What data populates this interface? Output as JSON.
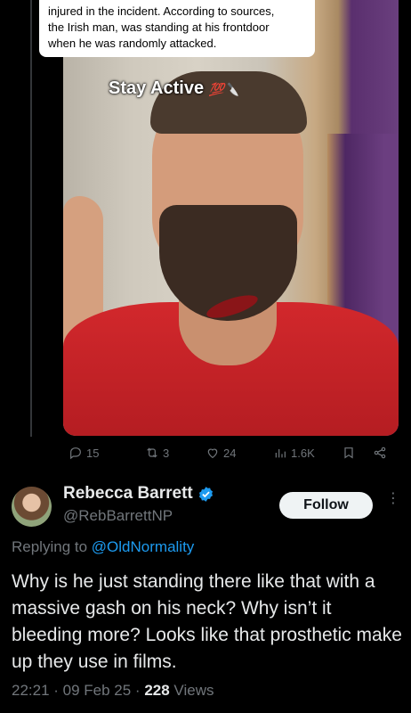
{
  "quoted_post": {
    "caption_lines": [
      "injured in the incident. According to sources,",
      "the Irish man, was standing at his frontdoor",
      "when he was randomly attacked."
    ],
    "overlay_text": "Stay Active",
    "overlay_emoji": "💯🔪"
  },
  "actions": {
    "replies": "15",
    "reposts": "3",
    "likes": "24",
    "views": "1.6K"
  },
  "reply": {
    "display_name": "Rebecca Barrett",
    "handle": "@RebBarrettNP",
    "follow_label": "Follow",
    "more_label": "⋮",
    "replying_prefix": "Replying to",
    "replying_to": "@OldNormality",
    "text": "Why is he just standing there like that with a massive gash on his neck? Why isn’t it bleeding more? Looks like that prosthetic make up they use in films.",
    "timestamp": "22:21 · 09 Feb 25 · ",
    "view_count": "228",
    "views_label": " Views"
  },
  "colors": {
    "accent": "#1d9bf0",
    "muted": "#71767b",
    "background": "#000000"
  }
}
